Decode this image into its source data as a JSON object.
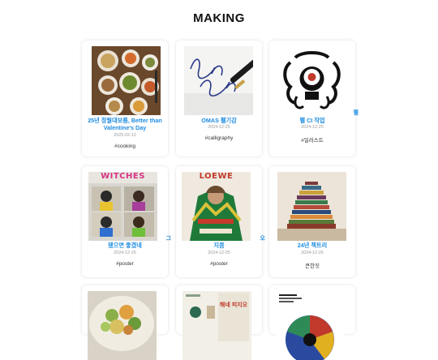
{
  "page": {
    "title": "MAKING"
  },
  "cards": [
    {
      "title": "25년 정월대보름, Better than Valentine's Day",
      "date": "2025-02-12",
      "tag": "#cooking",
      "thumb_icon": "food-platter-image"
    },
    {
      "title": "OMAS 펠기감",
      "date": "2024-12-25",
      "tag": "#calligraphy",
      "thumb_icon": "calligraphy-pen-image"
    },
    {
      "title": "펠 CI 작업",
      "date": "2024-12-25",
      "tag": "#일러스트",
      "side_glyph": "펠",
      "thumb_icon": "logo-illustration-image"
    },
    {
      "title": "됐으면 좋겠네",
      "date": "2024-12-25",
      "tag": "#poster",
      "side_glyph": "그",
      "thumb_icon": "magazine-poster-image",
      "poster_text": "WITCHES"
    },
    {
      "title": "지콤",
      "date": "2024-12-25",
      "tag": "#poster",
      "side_glyph": "오",
      "thumb_icon": "portrait-poster-image",
      "poster_text": "LOEWE"
    },
    {
      "title": "24년 책트리",
      "date": "2024-12-25",
      "tag": "큰한짓",
      "thumb_icon": "book-tree-image"
    },
    {
      "title": "",
      "date": "",
      "tag": "",
      "thumb_icon": "salad-bowl-image"
    },
    {
      "title": "",
      "date": "",
      "tag": "",
      "thumb_icon": "starbucks-card-image",
      "card_text": "해네 피지오"
    },
    {
      "title": "",
      "date": "",
      "tag": "",
      "thumb_icon": "color-wheel-image"
    }
  ]
}
